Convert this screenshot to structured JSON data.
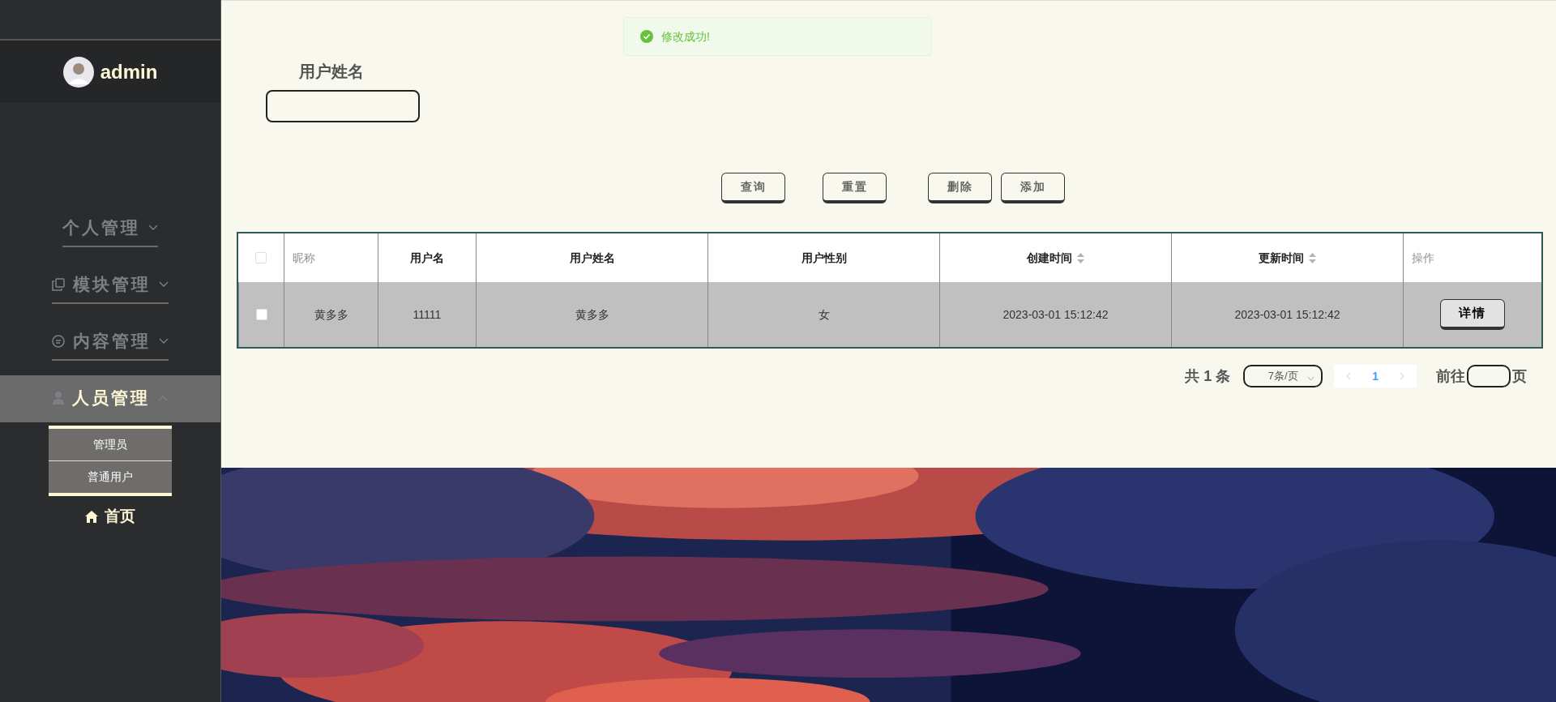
{
  "user": {
    "name": "admin"
  },
  "menu": [
    {
      "label": "个人管理",
      "expanded": false,
      "selected": false
    },
    {
      "label": "模块管理",
      "expanded": false,
      "selected": false
    },
    {
      "label": "内容管理",
      "expanded": false,
      "selected": false
    },
    {
      "label": "人员管理",
      "expanded": true,
      "selected": true,
      "children": [
        {
          "label": "管理员"
        },
        {
          "label": "普通用户"
        }
      ]
    }
  ],
  "home": {
    "label": "首页"
  },
  "toast": {
    "message": "修改成功!"
  },
  "search": {
    "label": "用户姓名"
  },
  "buttons": [
    "查询",
    "重置",
    "删除",
    "添加"
  ],
  "table": {
    "select_all": {
      "checked": false
    },
    "columns": [
      {
        "label": "昵称",
        "kind": "muted",
        "sortable": false
      },
      {
        "label": "用户名",
        "kind": "strong",
        "sortable": false
      },
      {
        "label": "用户姓名",
        "kind": "strong",
        "sortable": false
      },
      {
        "label": "用户性别",
        "kind": "strong",
        "sortable": false
      },
      {
        "label": "创建时间",
        "kind": "strong",
        "sortable": true
      },
      {
        "label": "更新时间",
        "kind": "strong",
        "sortable": true
      },
      {
        "label": "操作",
        "kind": "muted",
        "sortable": false
      }
    ],
    "rows": [
      {
        "selected": false,
        "cells": [
          "黄多多",
          "11111",
          "黄多多",
          "女",
          "2023-03-01 15:12:42",
          "2023-03-01 15:12:42"
        ],
        "action": "详情"
      }
    ]
  },
  "pagination": {
    "total": "共 1 条",
    "page_size": "7条/页",
    "pages": [
      {
        "label": "1",
        "selected": true
      }
    ],
    "goto": "前往",
    "goto_suffix": "页"
  }
}
